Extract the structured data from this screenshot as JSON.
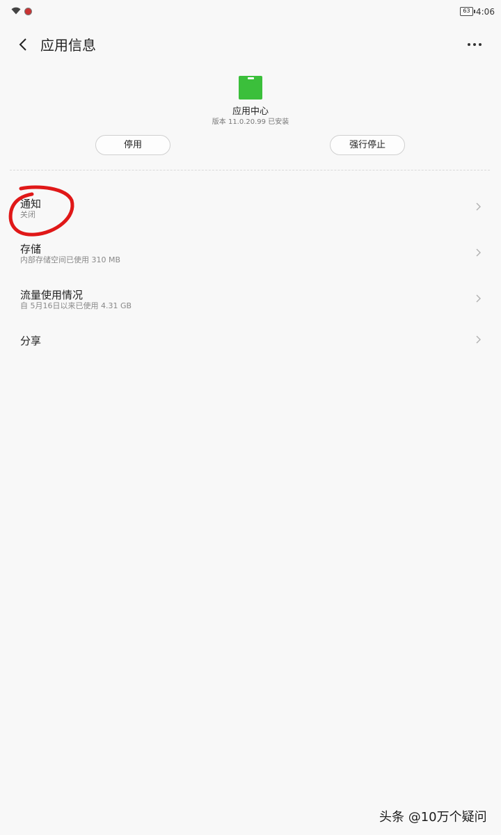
{
  "status_bar": {
    "battery": "63",
    "time": "4:06"
  },
  "header": {
    "title": "应用信息"
  },
  "app": {
    "name": "应用中心",
    "version": "版本 11.0.20.99 已安装",
    "icon_color": "#3bbf3b"
  },
  "actions": {
    "disable_label": "停用",
    "force_stop_label": "强行停止"
  },
  "rows": [
    {
      "title": "通知",
      "subtitle": "关闭"
    },
    {
      "title": "存储",
      "subtitle": "内部存储空间已使用 310 MB"
    },
    {
      "title": "流量使用情况",
      "subtitle": "自 5月16日以来已使用 4.31 GB"
    },
    {
      "title": "分享",
      "subtitle": ""
    }
  ],
  "annotation_color": "#e01818",
  "watermark": "头条 @10万个疑问"
}
